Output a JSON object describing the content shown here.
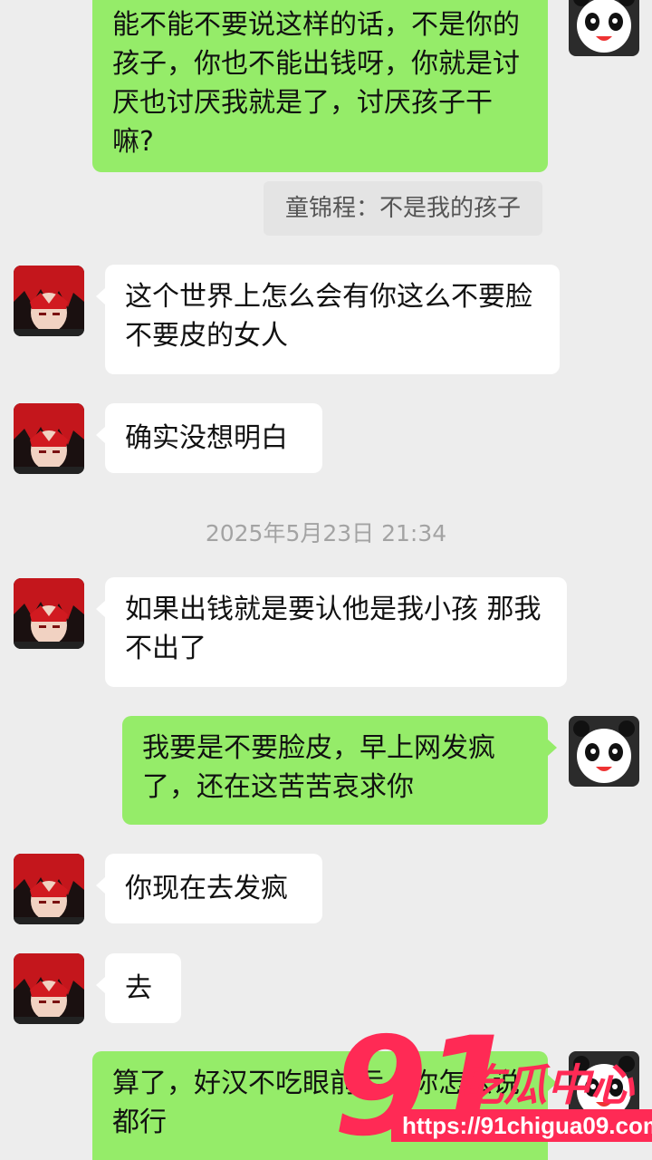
{
  "messages": [
    {
      "direction": "outgoing",
      "text": "能不能不要说这样的话，不是你的孩子，你也不能出钱呀，你就是讨厌也讨厌我就是了，讨厌孩子干嘛?"
    },
    {
      "direction": "quote",
      "text": "童锦程：不是我的孩子"
    },
    {
      "direction": "incoming",
      "text": "这个世界上怎么会有你这么不要脸不要皮的女人"
    },
    {
      "direction": "incoming",
      "text": "确实没想明白"
    },
    {
      "direction": "timestamp",
      "text": "2025年5月23日 21:34"
    },
    {
      "direction": "incoming",
      "text": "如果出钱就是要认他是我小孩 那我不出了"
    },
    {
      "direction": "outgoing",
      "text": "我要是不要脸皮，早上网发疯了，还在这苦苦哀求你"
    },
    {
      "direction": "incoming",
      "text": "你现在去发疯"
    },
    {
      "direction": "incoming",
      "text": "去"
    },
    {
      "direction": "outgoing",
      "text": "算了，好汉不吃眼前亏，你怎么说都行"
    }
  ],
  "avatars": {
    "me": "panda-avatar-icon",
    "contact": "red-hair-anime-avatar-icon"
  },
  "watermark": {
    "number": "91",
    "title": "吃瓜中心",
    "url": "https://91chigua09.com"
  },
  "colors": {
    "background": "#ededed",
    "outgoing_bubble": "#95ec69",
    "incoming_bubble": "#ffffff",
    "watermark": "#ff2a55"
  }
}
